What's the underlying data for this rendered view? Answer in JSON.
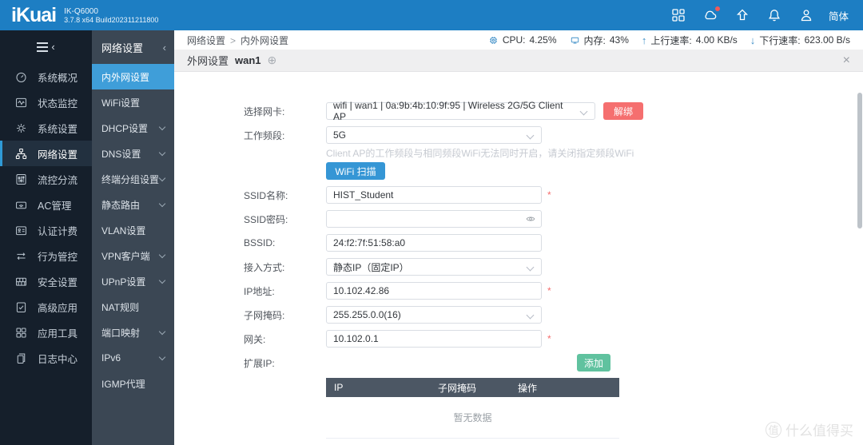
{
  "topbar": {
    "logo": "iKuai",
    "model": "IK-Q6000",
    "build": "3.7.8 x64 Build202311211800",
    "lang": "简体",
    "icons": [
      "apps-icon",
      "cloud-message-icon",
      "upgrade-icon",
      "bell-icon",
      "user-icon"
    ]
  },
  "status": {
    "cpu_label": "CPU:",
    "cpu_value": "4.25%",
    "mem_label": "内存:",
    "mem_value": "43%",
    "up_label": "上行速率:",
    "up_value": "4.00 KB/s",
    "down_label": "下行速率:",
    "down_value": "623.00 B/s"
  },
  "breadcrumb": {
    "root": "网络设置",
    "sep": ">",
    "current": "内外网设置"
  },
  "sidebar": {
    "items": [
      {
        "label": "系统概况",
        "icon": "gauge-icon"
      },
      {
        "label": "状态监控",
        "icon": "monitor-wave-icon"
      },
      {
        "label": "系统设置",
        "icon": "gear-icon"
      },
      {
        "label": "网络设置",
        "icon": "network-icon",
        "selected": true
      },
      {
        "label": "流控分流",
        "icon": "sliders-icon"
      },
      {
        "label": "AC管理",
        "icon": "wifi-device-icon"
      },
      {
        "label": "认证计费",
        "icon": "id-card-icon"
      },
      {
        "label": "行为管控",
        "icon": "swap-arrows-icon"
      },
      {
        "label": "安全设置",
        "icon": "firewall-icon"
      },
      {
        "label": "高级应用",
        "icon": "doc-check-icon"
      },
      {
        "label": "应用工具",
        "icon": "grid-tools-icon"
      },
      {
        "label": "日志中心",
        "icon": "logs-icon"
      }
    ]
  },
  "submenu": {
    "title": "网络设置",
    "collapse_icon": "‹",
    "items": [
      {
        "label": "内外网设置",
        "selected": true,
        "expandable": false
      },
      {
        "label": "WiFi设置",
        "expandable": false
      },
      {
        "label": "DHCP设置",
        "expandable": true
      },
      {
        "label": "DNS设置",
        "expandable": true
      },
      {
        "label": "终端分组设置",
        "expandable": true
      },
      {
        "label": "静态路由",
        "expandable": true
      },
      {
        "label": "VLAN设置",
        "expandable": false
      },
      {
        "label": "VPN客户端",
        "expandable": true
      },
      {
        "label": "UPnP设置",
        "expandable": true
      },
      {
        "label": "NAT规则",
        "expandable": false
      },
      {
        "label": "端口映射",
        "expandable": true
      },
      {
        "label": "IPv6",
        "expandable": true
      },
      {
        "label": "IGMP代理",
        "expandable": false
      }
    ]
  },
  "tab": {
    "title": "外网设置",
    "name": "wan1",
    "add_icon": "⊕",
    "close_icon": "×"
  },
  "form": {
    "required_marker": "*",
    "nic": {
      "label": "选择网卡:",
      "value": "wifi | wan1 | 0a:9b:4b:10:9f:95 | Wireless 2G/5G Client AP",
      "action": "解绑"
    },
    "band": {
      "label": "工作频段:",
      "value": "5G",
      "hint": "Client AP的工作频段与相同频段WiFi无法同时开启，请关闭指定频段WiFi"
    },
    "scan_button": "WiFi 扫描",
    "ssid": {
      "label": "SSID名称:",
      "value": "HIST_Student"
    },
    "password": {
      "label": "SSID密码:",
      "value": ""
    },
    "bssid": {
      "label": "BSSID:",
      "value": "24:f2:7f:51:58:a0"
    },
    "access": {
      "label": "接入方式:",
      "value": "静态IP（固定IP）"
    },
    "ip": {
      "label": "IP地址:",
      "value": "10.102.42.86"
    },
    "mask": {
      "label": "子网掩码:",
      "value": "255.255.0.0(16)"
    },
    "gateway": {
      "label": "网关:",
      "value": "10.102.0.1"
    },
    "ext_ip": {
      "label": "扩展IP:",
      "action": "添加"
    }
  },
  "ext_table": {
    "headers": [
      "IP",
      "子网掩码",
      "操作"
    ],
    "empty_text": "暂无数据"
  },
  "watermark": {
    "logo": "值",
    "text": "什么值得买"
  },
  "colors": {
    "topbar": "#1d7ec3",
    "accent": "#3f9ed9",
    "danger": "#f56f6f",
    "success": "#60c29f",
    "table_header": "#4c5764"
  }
}
